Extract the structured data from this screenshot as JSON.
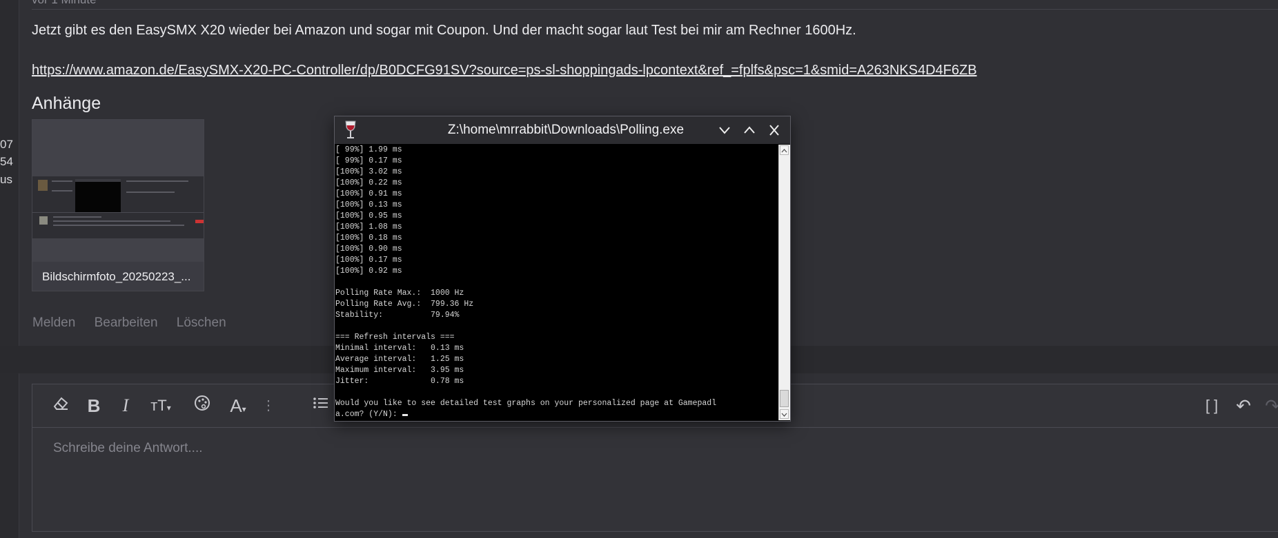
{
  "gutter": [
    "07",
    "54",
    "us"
  ],
  "post": {
    "time": "vor 1 Minute",
    "text": "Jetzt gibt es den EasySMX X20 wieder bei Amazon und sogar mit Coupon. Und der macht sogar laut Test bei mir am Rechner 1600Hz.",
    "link": "https://www.amazon.de/EasySMX-X20-PC-Controller/dp/B0DCFG91SV?source=ps-sl-shoppingads-lpcontext&ref_=fplfs&psc=1&smid=A263NKS4D4F6ZB"
  },
  "attachments": {
    "title": "Anhänge",
    "items": [
      {
        "name": "Bildschirmfoto_20250223_..."
      }
    ]
  },
  "actions": {
    "report": "Melden",
    "edit": "Bearbeiten",
    "delete": "Löschen"
  },
  "editor": {
    "placeholder": "Schreibe deine Antwort...."
  },
  "window": {
    "title": "Z:\\home\\mrrabbit\\Downloads\\Polling.exe",
    "console_lines": [
      "[ 99%] 1.99 ms",
      "[ 99%] 0.17 ms",
      "[100%] 3.02 ms",
      "[100%] 0.22 ms",
      "[100%] 0.91 ms",
      "[100%] 0.13 ms",
      "[100%] 0.95 ms",
      "[100%] 1.08 ms",
      "[100%] 0.18 ms",
      "[100%] 0.90 ms",
      "[100%] 0.17 ms",
      "[100%] 0.92 ms",
      "",
      "Polling Rate Max.:  1000 Hz",
      "Polling Rate Avg.:  799.36 Hz",
      "Stability:          79.94%",
      "",
      "=== Refresh intervals ===",
      "Minimal interval:   0.13 ms",
      "Average interval:   1.25 ms",
      "Maximum interval:   3.95 ms",
      "Jitter:             0.78 ms",
      "",
      "Would you like to see detailed test graphs on your personalized page at Gamepadl",
      "a.com? (Y/N): "
    ]
  }
}
